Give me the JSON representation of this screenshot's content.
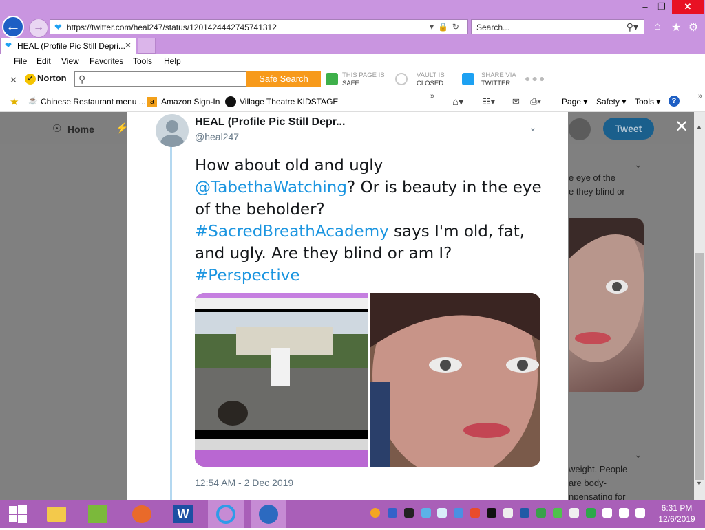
{
  "browser": {
    "url": "https://twitter.com/heal247/status/1201424442745741312",
    "search_placeholder": "Search...",
    "tab_title": "HEAL (Profile Pic Still Depri...",
    "menu": [
      "File",
      "Edit",
      "View",
      "Favorites",
      "Tools",
      "Help"
    ]
  },
  "norton": {
    "logo": "Norton",
    "safe_search": "Safe Search",
    "status1_top": "THIS PAGE IS",
    "status1_bottom": "SAFE",
    "status2_top": "VAULT IS",
    "status2_bottom": "CLOSED",
    "status3_top": "SHARE VIA",
    "status3_bottom": "TWITTER"
  },
  "favorites": {
    "items": [
      "Chinese Restaurant menu ...",
      "Amazon Sign-In",
      "Village Theatre  KIDSTAGE"
    ],
    "commands": [
      "Page ▾",
      "Safety ▾",
      "Tools ▾"
    ]
  },
  "twitter": {
    "nav_home": "Home",
    "tweet_button": "Tweet",
    "bg_text_top": [
      "e eye of the",
      "e they blind or"
    ],
    "bg_text_bottom": [
      "weight.  People",
      "are body-",
      "npensating for"
    ]
  },
  "tweet": {
    "display_name": "HEAL (Profile Pic Still Depr...",
    "handle": "@heal247",
    "text_part1": "How about old and ugly",
    "mention": "@TabethaWatching",
    "text_part2": "?  Or is beauty in the eye of the beholder?",
    "hashtag1": "#SacredBreathAcademy",
    "text_part3": " says I'm old, fat, and ugly.  Are they blind or am I?",
    "hashtag2": "#Perspective",
    "timestamp": "12:54 AM - 2 Dec 2019"
  },
  "taskbar": {
    "time": "6:31 PM",
    "date": "12/6/2019"
  },
  "colors": {
    "chrome": "#c995e0",
    "taskbar": "#a95fb8",
    "twitter_blue": "#1b95e0"
  }
}
